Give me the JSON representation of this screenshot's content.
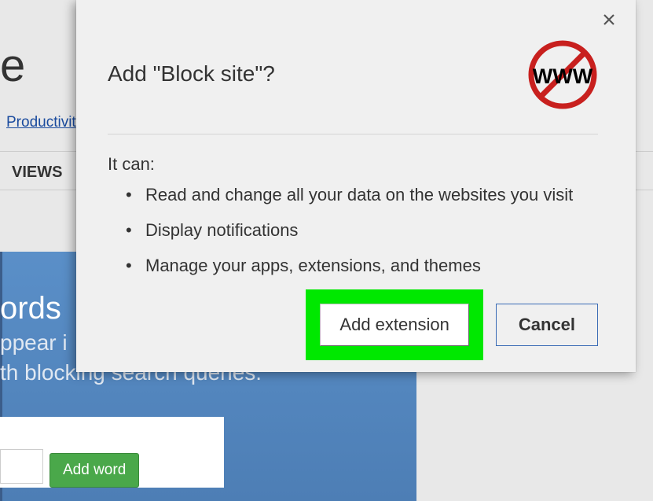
{
  "background": {
    "title_fragment": "e",
    "category_link": "Productivit",
    "tab_label": "VIEWS",
    "blue_panel": {
      "line1": "ords",
      "line2": "ppear i",
      "line3": "th blocking search queries."
    },
    "add_word_button": "Add word"
  },
  "dialog": {
    "title": "Add \"Block site\"?",
    "icon_label": "WWW",
    "subtitle": "It can:",
    "permissions": [
      "Read and change all your data on the websites you visit",
      "Display notifications",
      "Manage your apps, extensions, and themes"
    ],
    "add_button": "Add extension",
    "cancel_button": "Cancel"
  }
}
